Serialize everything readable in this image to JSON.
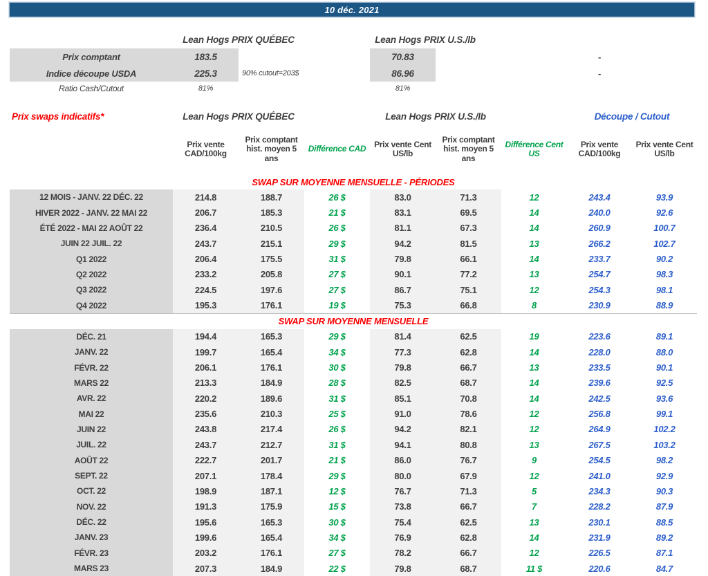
{
  "topbar": {
    "date": "10 déc. 2021"
  },
  "colors": {
    "banner_blue": "#1c5685",
    "accent_red": "#fa0000",
    "accent_green": "#00a24d",
    "accent_blue": "#2c5ecb",
    "label_gray": "#d9d9d9",
    "shade_gray": "#f1f1f1",
    "text_dark": "#3f3f3f"
  },
  "summary": {
    "quebec_title": "Lean Hogs PRIX QUÉBEC",
    "us_title": "Lean Hogs PRIX U.S./lb",
    "rows": [
      {
        "label": "Prix comptant",
        "qc": "183.5",
        "note": "",
        "us": "70.83",
        "dash": "-"
      },
      {
        "label": "Indice découpe USDA",
        "qc": "225.3",
        "note": "90% cutout=203$",
        "us": "86.96",
        "dash": "-"
      },
      {
        "label": "Ratio Cash/Cutout",
        "qc": "81%",
        "note": "",
        "us": "81%",
        "dash": ""
      }
    ]
  },
  "swaps": {
    "title": "Prix swaps indicatifs*",
    "quebec_title": "Lean Hogs PRIX QUÉBEC",
    "us_title": "Lean Hogs PRIX U.S./lb",
    "cutout_title": "Découpe / Cutout",
    "columns": [
      "Prix vente CAD/100kg",
      "Prix comptant hist. moyen 5 ans",
      "Différence CAD",
      "Prix vente Cent US/lb",
      "Prix comptant hist. moyen 5 ans",
      "Différence Cent US",
      "Prix vente CAD/100kg",
      "Prix vente Cent US/lb"
    ]
  },
  "sections": [
    {
      "title": "SWAP SUR MOYENNE MENSUELLE - PÉRIODES",
      "rows": [
        [
          "12 MOIS - JANV. 22 DÉC. 22",
          "214.8",
          "188.7",
          "26 $",
          "83.0",
          "71.3",
          "12",
          "243.4",
          "93.9"
        ],
        [
          "HIVER 2022 - JANV. 22 MAI 22",
          "206.7",
          "185.3",
          "21 $",
          "83.1",
          "69.5",
          "14",
          "240.0",
          "92.6"
        ],
        [
          "ÉTÉ 2022 - MAI 22 AOÛT 22",
          "236.4",
          "210.5",
          "26 $",
          "81.1",
          "67.3",
          "14",
          "260.9",
          "100.7"
        ],
        [
          "JUIN 22 JUIL. 22",
          "243.7",
          "215.1",
          "29 $",
          "94.2",
          "81.5",
          "13",
          "266.2",
          "102.7"
        ],
        [
          "Q1 2022",
          "206.4",
          "175.5",
          "31 $",
          "79.8",
          "66.1",
          "14",
          "233.7",
          "90.2"
        ],
        [
          "Q2 2022",
          "233.2",
          "205.8",
          "27 $",
          "90.1",
          "77.2",
          "13",
          "254.7",
          "98.3"
        ],
        [
          "Q3 2022",
          "224.5",
          "197.6",
          "27 $",
          "86.7",
          "75.1",
          "12",
          "254.3",
          "98.1"
        ],
        [
          "Q4 2022",
          "195.3",
          "176.1",
          "19 $",
          "75.3",
          "66.8",
          "8",
          "230.9",
          "88.9"
        ]
      ]
    },
    {
      "title": "SWAP SUR MOYENNE MENSUELLE",
      "rows": [
        [
          "DÉC. 21",
          "194.4",
          "165.3",
          "29 $",
          "81.4",
          "62.5",
          "19",
          "223.6",
          "89.1"
        ],
        [
          "JANV. 22",
          "199.7",
          "165.4",
          "34 $",
          "77.3",
          "62.8",
          "14",
          "228.0",
          "88.0"
        ],
        [
          "FÉVR. 22",
          "206.1",
          "176.1",
          "30 $",
          "79.8",
          "66.7",
          "13",
          "233.5",
          "90.1"
        ],
        [
          "MARS 22",
          "213.3",
          "184.9",
          "28 $",
          "82.5",
          "68.7",
          "14",
          "239.6",
          "92.5"
        ],
        [
          "AVR. 22",
          "220.2",
          "189.6",
          "31 $",
          "85.1",
          "70.8",
          "14",
          "242.5",
          "93.6"
        ],
        [
          "MAI 22",
          "235.6",
          "210.3",
          "25 $",
          "91.0",
          "78.6",
          "12",
          "256.8",
          "99.1"
        ],
        [
          "JUIN 22",
          "243.8",
          "217.4",
          "26 $",
          "94.2",
          "82.1",
          "12",
          "264.9",
          "102.2"
        ],
        [
          "JUIL. 22",
          "243.7",
          "212.7",
          "31 $",
          "94.1",
          "80.8",
          "13",
          "267.5",
          "103.2"
        ],
        [
          "AOÛT 22",
          "222.7",
          "201.7",
          "21 $",
          "86.0",
          "76.7",
          "9",
          "254.5",
          "98.2"
        ],
        [
          "SEPT. 22",
          "207.1",
          "178.4",
          "29 $",
          "80.0",
          "67.9",
          "12",
          "241.0",
          "92.9"
        ],
        [
          "OCT. 22",
          "198.9",
          "187.1",
          "12 $",
          "76.7",
          "71.3",
          "5",
          "234.3",
          "90.3"
        ],
        [
          "NOV. 22",
          "191.3",
          "175.9",
          "15 $",
          "73.8",
          "66.7",
          "7",
          "228.2",
          "87.9"
        ],
        [
          "DÉC. 22",
          "195.6",
          "165.3",
          "30 $",
          "75.4",
          "62.5",
          "13",
          "230.1",
          "88.5"
        ],
        [
          "JANV. 23",
          "199.6",
          "165.4",
          "34 $",
          "76.9",
          "62.8",
          "14",
          "231.9",
          "89.2"
        ],
        [
          "FÉVR. 23",
          "203.2",
          "176.1",
          "27 $",
          "78.2",
          "66.7",
          "12",
          "226.5",
          "87.1"
        ],
        [
          "MARS 23",
          "207.3",
          "184.9",
          "22 $",
          "79.8",
          "68.7",
          "11 $",
          "220.6",
          "84.7"
        ]
      ]
    }
  ]
}
